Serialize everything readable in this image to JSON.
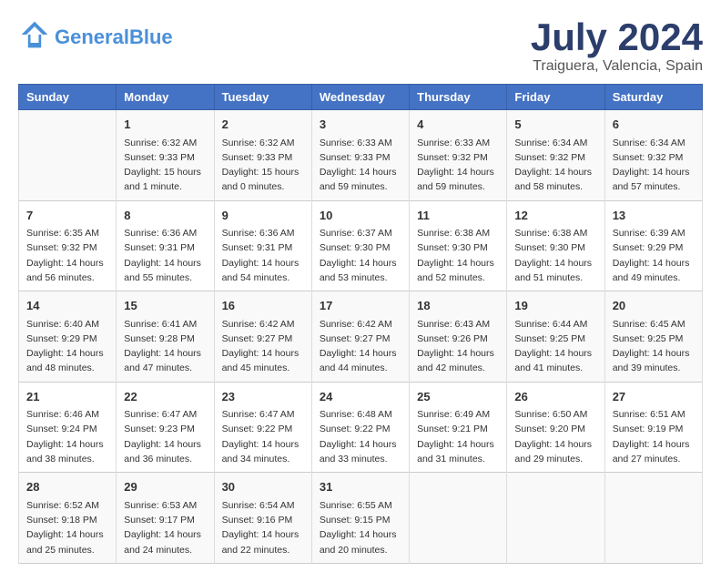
{
  "header": {
    "logo_general": "General",
    "logo_blue": "Blue",
    "month_year": "July 2024",
    "location": "Traiguera, Valencia, Spain"
  },
  "days_of_week": [
    "Sunday",
    "Monday",
    "Tuesday",
    "Wednesday",
    "Thursday",
    "Friday",
    "Saturday"
  ],
  "weeks": [
    [
      {
        "day": "",
        "info": ""
      },
      {
        "day": "1",
        "info": "Sunrise: 6:32 AM\nSunset: 9:33 PM\nDaylight: 15 hours\nand 1 minute."
      },
      {
        "day": "2",
        "info": "Sunrise: 6:32 AM\nSunset: 9:33 PM\nDaylight: 15 hours\nand 0 minutes."
      },
      {
        "day": "3",
        "info": "Sunrise: 6:33 AM\nSunset: 9:33 PM\nDaylight: 14 hours\nand 59 minutes."
      },
      {
        "day": "4",
        "info": "Sunrise: 6:33 AM\nSunset: 9:32 PM\nDaylight: 14 hours\nand 59 minutes."
      },
      {
        "day": "5",
        "info": "Sunrise: 6:34 AM\nSunset: 9:32 PM\nDaylight: 14 hours\nand 58 minutes."
      },
      {
        "day": "6",
        "info": "Sunrise: 6:34 AM\nSunset: 9:32 PM\nDaylight: 14 hours\nand 57 minutes."
      }
    ],
    [
      {
        "day": "7",
        "info": "Sunrise: 6:35 AM\nSunset: 9:32 PM\nDaylight: 14 hours\nand 56 minutes."
      },
      {
        "day": "8",
        "info": "Sunrise: 6:36 AM\nSunset: 9:31 PM\nDaylight: 14 hours\nand 55 minutes."
      },
      {
        "day": "9",
        "info": "Sunrise: 6:36 AM\nSunset: 9:31 PM\nDaylight: 14 hours\nand 54 minutes."
      },
      {
        "day": "10",
        "info": "Sunrise: 6:37 AM\nSunset: 9:30 PM\nDaylight: 14 hours\nand 53 minutes."
      },
      {
        "day": "11",
        "info": "Sunrise: 6:38 AM\nSunset: 9:30 PM\nDaylight: 14 hours\nand 52 minutes."
      },
      {
        "day": "12",
        "info": "Sunrise: 6:38 AM\nSunset: 9:30 PM\nDaylight: 14 hours\nand 51 minutes."
      },
      {
        "day": "13",
        "info": "Sunrise: 6:39 AM\nSunset: 9:29 PM\nDaylight: 14 hours\nand 49 minutes."
      }
    ],
    [
      {
        "day": "14",
        "info": "Sunrise: 6:40 AM\nSunset: 9:29 PM\nDaylight: 14 hours\nand 48 minutes."
      },
      {
        "day": "15",
        "info": "Sunrise: 6:41 AM\nSunset: 9:28 PM\nDaylight: 14 hours\nand 47 minutes."
      },
      {
        "day": "16",
        "info": "Sunrise: 6:42 AM\nSunset: 9:27 PM\nDaylight: 14 hours\nand 45 minutes."
      },
      {
        "day": "17",
        "info": "Sunrise: 6:42 AM\nSunset: 9:27 PM\nDaylight: 14 hours\nand 44 minutes."
      },
      {
        "day": "18",
        "info": "Sunrise: 6:43 AM\nSunset: 9:26 PM\nDaylight: 14 hours\nand 42 minutes."
      },
      {
        "day": "19",
        "info": "Sunrise: 6:44 AM\nSunset: 9:25 PM\nDaylight: 14 hours\nand 41 minutes."
      },
      {
        "day": "20",
        "info": "Sunrise: 6:45 AM\nSunset: 9:25 PM\nDaylight: 14 hours\nand 39 minutes."
      }
    ],
    [
      {
        "day": "21",
        "info": "Sunrise: 6:46 AM\nSunset: 9:24 PM\nDaylight: 14 hours\nand 38 minutes."
      },
      {
        "day": "22",
        "info": "Sunrise: 6:47 AM\nSunset: 9:23 PM\nDaylight: 14 hours\nand 36 minutes."
      },
      {
        "day": "23",
        "info": "Sunrise: 6:47 AM\nSunset: 9:22 PM\nDaylight: 14 hours\nand 34 minutes."
      },
      {
        "day": "24",
        "info": "Sunrise: 6:48 AM\nSunset: 9:22 PM\nDaylight: 14 hours\nand 33 minutes."
      },
      {
        "day": "25",
        "info": "Sunrise: 6:49 AM\nSunset: 9:21 PM\nDaylight: 14 hours\nand 31 minutes."
      },
      {
        "day": "26",
        "info": "Sunrise: 6:50 AM\nSunset: 9:20 PM\nDaylight: 14 hours\nand 29 minutes."
      },
      {
        "day": "27",
        "info": "Sunrise: 6:51 AM\nSunset: 9:19 PM\nDaylight: 14 hours\nand 27 minutes."
      }
    ],
    [
      {
        "day": "28",
        "info": "Sunrise: 6:52 AM\nSunset: 9:18 PM\nDaylight: 14 hours\nand 25 minutes."
      },
      {
        "day": "29",
        "info": "Sunrise: 6:53 AM\nSunset: 9:17 PM\nDaylight: 14 hours\nand 24 minutes."
      },
      {
        "day": "30",
        "info": "Sunrise: 6:54 AM\nSunset: 9:16 PM\nDaylight: 14 hours\nand 22 minutes."
      },
      {
        "day": "31",
        "info": "Sunrise: 6:55 AM\nSunset: 9:15 PM\nDaylight: 14 hours\nand 20 minutes."
      },
      {
        "day": "",
        "info": ""
      },
      {
        "day": "",
        "info": ""
      },
      {
        "day": "",
        "info": ""
      }
    ]
  ]
}
